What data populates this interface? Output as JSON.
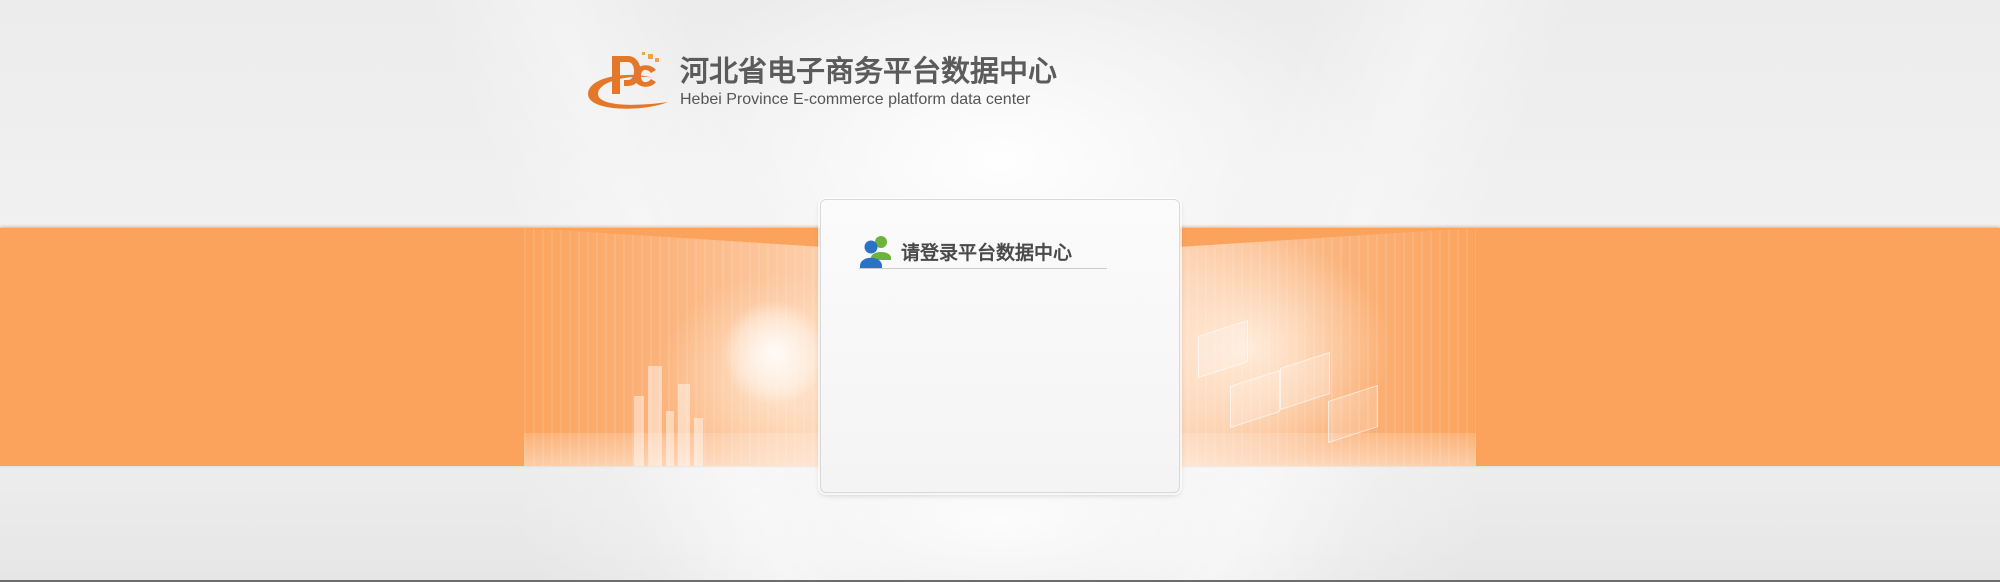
{
  "header": {
    "logo": "dc-logo",
    "title_cn": "河北省电子商务平台数据中心",
    "title_en": "Hebei Province E-commerce platform data center"
  },
  "login": {
    "icon": "users-icon",
    "title": "请登录平台数据中心"
  },
  "colors": {
    "band_orange": "#fba35c",
    "logo_orange": "#e4782a",
    "title_gray": "#5b5b5b",
    "icon_blue": "#2a72c5",
    "icon_green": "#6cb33e"
  }
}
